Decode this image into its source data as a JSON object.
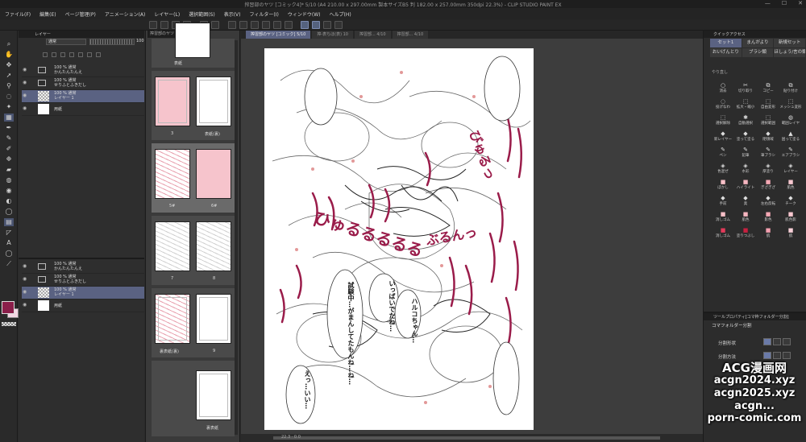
{
  "window": {
    "title": "搾習部のヤツ [コミック4]* 5/10 (A4 210.00 x 297.00mm 製本サイズB5 判 182.00 x 257.00mm 350dpi 22.3%) - CLIP STUDIO PAINT EX",
    "min": "—",
    "max": "☐",
    "close": "✕"
  },
  "menu": [
    "ファイル(F)",
    "編集(E)",
    "ページ管理(P)",
    "アニメーション(A)",
    "レイヤー(L)",
    "選択範囲(S)",
    "表示(V)",
    "フィルター(I)",
    "ウィンドウ(W)",
    "ヘルプ(H)"
  ],
  "layer_panel": {
    "tab_label": "レイヤー",
    "blend_mode": "通常",
    "opacity": "100",
    "group1": [
      {
        "line1": "100 % 通常",
        "line2": "かんたんたんえ",
        "type": "folder"
      },
      {
        "line1": "100 % 通常",
        "line2": "せりふとふきだし",
        "type": "folder"
      },
      {
        "line1": "100 % 通常",
        "line2": "レイヤー 1",
        "type": "raster",
        "selected": true
      },
      {
        "line1": "用紙",
        "line2": "",
        "type": "paper"
      }
    ],
    "group2": [
      {
        "line1": "100 % 通常",
        "line2": "かんたんたんえ",
        "type": "folder"
      },
      {
        "line1": "100 % 通常",
        "line2": "せりふとふきだし",
        "type": "folder"
      },
      {
        "line1": "100 % 通常",
        "line2": "レイヤー 1",
        "type": "raster",
        "selected": true
      },
      {
        "line1": "用紙",
        "line2": "",
        "type": "paper"
      }
    ]
  },
  "page_panel": {
    "tab_label": "搾習部のヤツ [コミック]",
    "labels": {
      "cover": "表紙",
      "p3": "3",
      "back_inner": "表紙(裏)",
      "p5": "5#",
      "p6": "6#",
      "p7": "7",
      "p8": "8",
      "cover_back": "裏表紙(裏)",
      "p9": "9",
      "back_cover": "裏表紙"
    }
  },
  "canvas": {
    "tabs": [
      {
        "label": "搾習部のヤツ [コミック] 5/10",
        "active": true
      },
      {
        "label": "搾-表ちほ(表) 10",
        "active": false
      },
      {
        "label": "搾習部... 4/10",
        "active": false
      },
      {
        "label": "搾習部... 4/10",
        "active": false
      }
    ],
    "zoom": "22.3",
    "angle": "0.0",
    "speech": {
      "b1": [
        "試験中…",
        "が",
        "まんし",
        "てたもんね…",
        "ね…"
      ],
      "b2": [
        "いっぱい",
        "でたね…"
      ],
      "b3": [
        "ハル",
        "コ",
        "ちゃん…"
      ],
      "b4": [
        "えっ…",
        "いい…"
      ]
    },
    "sfx": [
      "ひゅるるるるる",
      "ぶるんっ",
      "びゅるっ"
    ]
  },
  "right_panel": {
    "tab_label": "クイックアクセス",
    "sets": [
      "セット1",
      "まんがより",
      "新規セット",
      "おいげんとり",
      "ブラシ類",
      "ほしょう/言の類"
    ],
    "section": "やり直し",
    "items": [
      {
        "icon": "○",
        "label": "消去"
      },
      {
        "icon": "✂",
        "label": "切り取り"
      },
      {
        "icon": "⧉",
        "label": "コピー"
      },
      {
        "icon": "⧉",
        "label": "貼り付け"
      },
      {
        "icon": "◌",
        "label": "投げなわ"
      },
      {
        "icon": "⬚",
        "label": "拡大・縮小"
      },
      {
        "icon": "⬚",
        "label": "自由変形"
      },
      {
        "icon": "⬚",
        "label": "メッシュ変形"
      },
      {
        "icon": "⬚",
        "label": "選択解除"
      },
      {
        "icon": "✱",
        "label": "自動選択"
      },
      {
        "icon": "⬚",
        "label": "選択範囲"
      },
      {
        "icon": "◍",
        "label": "範囲レイヤ"
      },
      {
        "icon": "◆",
        "label": "新レイヤー"
      },
      {
        "icon": "◆",
        "label": "塗って塗る"
      },
      {
        "icon": "◆",
        "label": "閉領域"
      },
      {
        "icon": "▲",
        "label": "囲って塗る"
      },
      {
        "icon": "✎",
        "label": "ペン"
      },
      {
        "icon": "✎",
        "label": "鉛筆"
      },
      {
        "icon": "✎",
        "label": "筆ブラシ"
      },
      {
        "icon": "✎",
        "label": "エアブラシ"
      },
      {
        "icon": "◈",
        "label": "色混ぜ"
      },
      {
        "icon": "◈",
        "label": "水彩"
      },
      {
        "icon": "◈",
        "label": "厚塗り"
      },
      {
        "icon": "◈",
        "label": "レイヤー"
      },
      {
        "icon": "■",
        "label": "ぼかし"
      },
      {
        "icon": "■",
        "label": "ハイライト"
      },
      {
        "icon": "■",
        "label": "ぎざぎざ"
      },
      {
        "icon": "■",
        "label": "肌色"
      },
      {
        "icon": "◆",
        "label": "手前"
      },
      {
        "icon": "◆",
        "label": "奥"
      },
      {
        "icon": "◆",
        "label": "左右反転"
      },
      {
        "icon": "◆",
        "label": "チーク"
      },
      {
        "icon": "■",
        "label": "消しゴム"
      },
      {
        "icon": "■",
        "label": "肌色"
      },
      {
        "icon": "■",
        "label": "影色"
      },
      {
        "icon": "■",
        "label": "肌色影"
      },
      {
        "icon": "■",
        "label": "消しゴム"
      },
      {
        "icon": "■",
        "label": "塗りつぶし"
      },
      {
        "icon": "■",
        "label": "肌"
      },
      {
        "icon": "■",
        "label": "肌"
      }
    ],
    "swatches": [
      "#f8c0c8",
      "#f6b6c0",
      "#f4a8b4",
      "#f8c8d0",
      "#e43a5a",
      "#c82040",
      "#f4a0b0",
      "#f8d0d8"
    ]
  },
  "tool_property": {
    "tab_label": "ツールプロパティ[コマ枠フォルダー分割]",
    "title": "コマフォルダー分割",
    "row1": "分割形状",
    "row2": "分割方法"
  },
  "watermarks": [
    "ACG漫画网",
    "acgn2024.xyz",
    "acgn2025.xyz",
    "acgn...",
    "porn-comic.com"
  ],
  "colors": {
    "main": "#8a1e4a",
    "sub": "#f4d7e4",
    "accent": "#5a6282"
  }
}
